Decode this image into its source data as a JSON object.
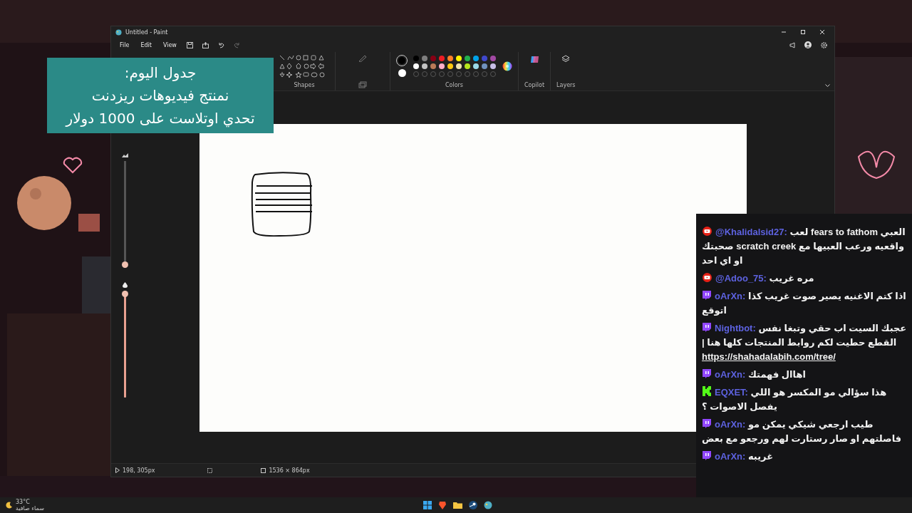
{
  "window": {
    "title": "Untitled - Paint",
    "menu": {
      "file": "File",
      "edit": "Edit",
      "view": "View"
    }
  },
  "ribbon": {
    "group_labels": {
      "shapes": "Shapes",
      "colors": "Colors",
      "copilot": "Copilot",
      "layers": "Layers"
    },
    "current_colors": [
      {
        "color": "#000000",
        "selected": true
      },
      {
        "color": "#ffffff",
        "selected": false
      }
    ],
    "palette": [
      {
        "color": "#000000"
      },
      {
        "color": "#7f7f7f"
      },
      {
        "color": "#880015"
      },
      {
        "color": "#ed1c24"
      },
      {
        "color": "#ff7f27"
      },
      {
        "color": "#fff200"
      },
      {
        "color": "#22b14c"
      },
      {
        "color": "#00a2e8"
      },
      {
        "color": "#3f48cc"
      },
      {
        "color": "#a349a4"
      },
      {
        "color": "#ffffff"
      },
      {
        "color": "#c3c3c3"
      },
      {
        "color": "#b97a57"
      },
      {
        "color": "#ffaec9"
      },
      {
        "color": "#ffc90e"
      },
      {
        "color": "#efe4b0"
      },
      {
        "color": "#b5e61d"
      },
      {
        "color": "#99d9ea"
      },
      {
        "color": "#7092be"
      },
      {
        "color": "#c8bfe7"
      }
    ]
  },
  "sliders": [
    {
      "level": 0.0
    },
    {
      "level": 1.0
    }
  ],
  "status_bar": {
    "cursor": "198, 305px",
    "size": "1536 × 864px"
  },
  "schedule": [
    "جدول اليوم:",
    "نمنتج فيديوهات ريزدنت",
    "تحدي اوتلاست على 1000 دولار"
  ],
  "chat": [
    {
      "kind": "youtube",
      "user": "@Khalidalsid27:",
      "text": "العبي fears to fathom لعب واقعيه ورعب العبيها مع scratch creek صحبتك او اي احد"
    },
    {
      "kind": "youtube",
      "user": "@Adoo_75:",
      "text": "مره غريب"
    },
    {
      "kind": "twitch",
      "user": "oArXn:",
      "text": "اذا كتم الاغنيه يصير صوت غريب كذا اتوقع"
    },
    {
      "kind": "twitch",
      "user": "Nightbot:",
      "text": "عجبك السيت اب حقي وتبغا نفس القطع حطيت لكم روابط المنتجات كلها هنا |",
      "link": "https://shahadalabih.com/tree/"
    },
    {
      "kind": "twitch",
      "user": "oArXn:",
      "text": "اهاال فهمتك"
    },
    {
      "kind": "kick",
      "user": "EQXET:",
      "text": "هذا سؤالي مو المكسر هو اللي يفصل الاصوات ؟"
    },
    {
      "kind": "twitch",
      "user": "oArXn:",
      "text": "طيب ارجعي شيكي يمكن مو فاصلتهم او صار رستارت لهم ورجعو مع بعض"
    },
    {
      "kind": "twitch",
      "user": "oArXn:",
      "text": "غريبه"
    }
  ],
  "taskbar": {
    "temperature": "33°C",
    "weather": "سماء صافية"
  }
}
